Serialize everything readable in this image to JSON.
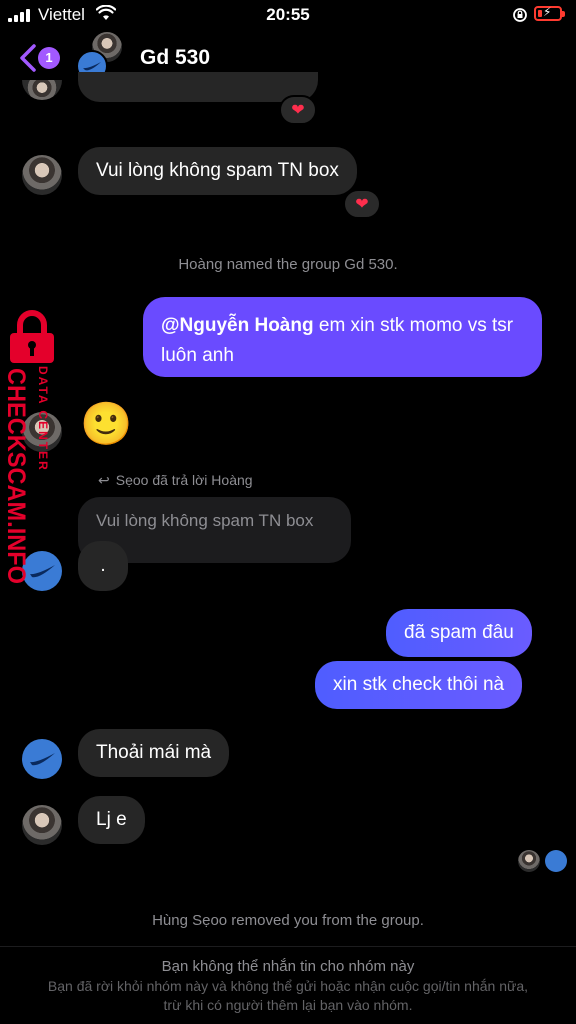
{
  "status_bar": {
    "carrier": "Viettel",
    "time": "20:55",
    "battery_color": "#ff3b30"
  },
  "header": {
    "back_badge_count": "1",
    "title": "Gd 530",
    "accent_color": "#a259ff"
  },
  "messages": [
    {
      "sender": "other",
      "text": "Vui lòng không spam TN box",
      "reaction": "heart"
    },
    {
      "type": "system",
      "text": "Hoàng named the group Gd 530."
    },
    {
      "sender": "me",
      "mention": "@Nguyễn Hoàng",
      "text": " em xin stk momo vs tsr luôn anh"
    },
    {
      "sender": "other",
      "emoji": "🙂"
    },
    {
      "type": "reply_meta",
      "text": "Sẹoo đã trả lời Hoàng"
    },
    {
      "sender": "other",
      "quoted": "Vui lòng không spam TN box",
      "text": "."
    },
    {
      "sender": "me",
      "text": "đã spam đâu"
    },
    {
      "sender": "me",
      "text": "xin stk check thôi nà"
    },
    {
      "sender": "other",
      "text": "Thoải mái mà"
    },
    {
      "sender": "other",
      "text": "Lj e"
    },
    {
      "type": "system",
      "text": "Hùng Sẹoo removed you from the group."
    }
  ],
  "footer": {
    "title": "Bạn không thể nhắn tin cho nhóm này",
    "subtitle": "Bạn đã rời khỏi nhóm này và không thể gửi hoặc nhận cuộc gọi/tin nhắn nữa, trừ khi có người thêm lại bạn vào nhóm."
  },
  "watermark": {
    "brand": "CHECKSCAM.INFO",
    "sub": "DATA CENTER",
    "color": "#e4002b"
  },
  "colors": {
    "incoming_bubble": "#262626",
    "outgoing_bubble": "#5b5cff",
    "system_text": "#8e8e93"
  }
}
